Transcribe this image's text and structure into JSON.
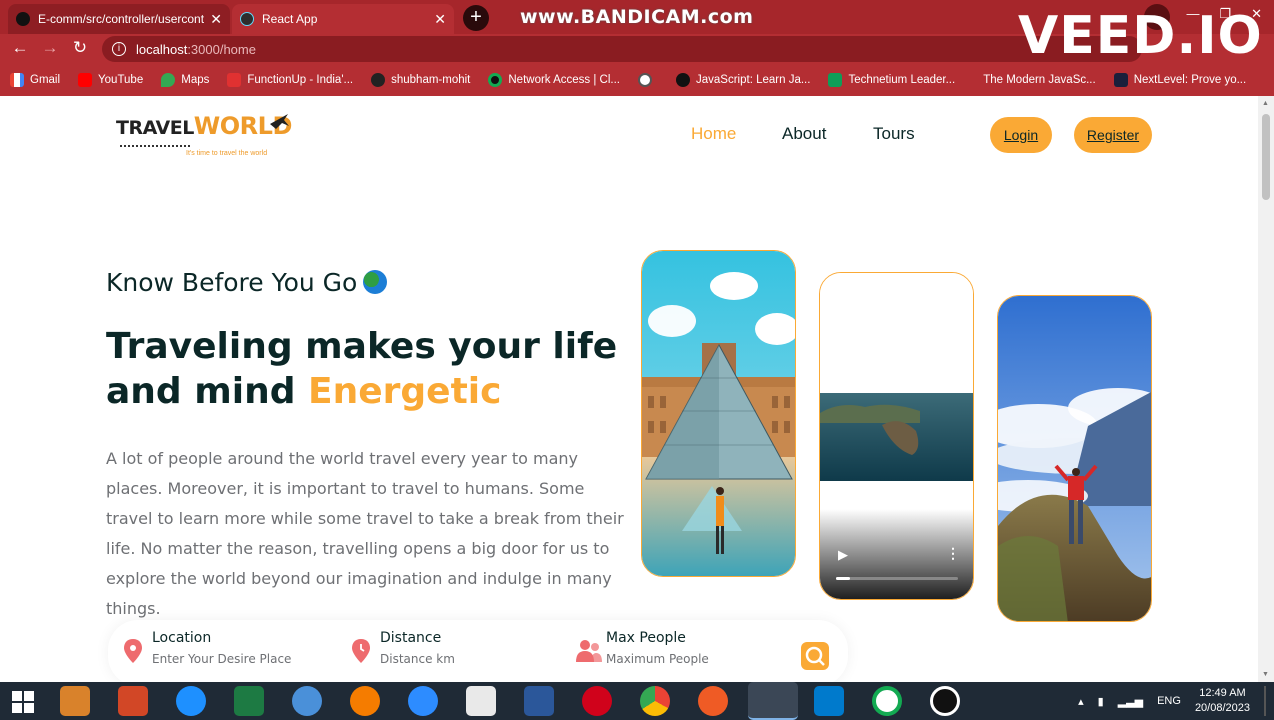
{
  "browser": {
    "tabs": [
      {
        "title": "E-comm/src/controller/usercontr",
        "active": false
      },
      {
        "title": "React App",
        "active": true
      }
    ],
    "url": {
      "host": "localhost",
      "path": ":3000/home"
    },
    "bookmarks": [
      {
        "label": "Gmail",
        "icon": "gmail-icon"
      },
      {
        "label": "YouTube",
        "icon": "youtube-icon"
      },
      {
        "label": "Maps",
        "icon": "maps-icon"
      },
      {
        "label": "FunctionUp - India'...",
        "icon": "functionup-icon"
      },
      {
        "label": "shubham-mohit",
        "icon": "github-icon"
      },
      {
        "label": "Network Access | Cl...",
        "icon": "mongodb-icon"
      },
      {
        "label": "",
        "icon": "globe-icon"
      },
      {
        "label": "JavaScript: Learn Ja...",
        "icon": "udemy-icon"
      },
      {
        "label": "Technetium Leader...",
        "icon": "sheets-icon"
      },
      {
        "label": "The Modern JavaSc...",
        "icon": "page-icon"
      },
      {
        "label": "NextLevel: Prove yo...",
        "icon": "nextlevel-icon"
      }
    ],
    "watermarks": {
      "bandicam": "www.BANDICAM.com",
      "veed": "VEED.IO"
    }
  },
  "site": {
    "logo": {
      "main": "TRAVEL",
      "accent": "WORLD",
      "tagline": "It's time to travel the world"
    },
    "nav": {
      "home": "Home",
      "about": "About",
      "tours": "Tours"
    },
    "auth": {
      "login": "Login",
      "register": "Register"
    },
    "hero": {
      "subtitle": "Know Before You Go",
      "headline_part1": "Traveling makes your life and mind ",
      "headline_highlight": "Energetic",
      "description": "A lot of people around the world travel every year to many places. Moreover, it is important to travel to humans. Some travel to learn more while some travel to take a break from their life. No matter the reason, travelling opens a big door for us to explore the world beyond our imagination and indulge in many things."
    },
    "search": {
      "location": {
        "label": "Location",
        "placeholder": "Enter Your Desire Place"
      },
      "distance": {
        "label": "Distance",
        "placeholder": "Distance km"
      },
      "people": {
        "label": "Max People",
        "placeholder": "Maximum People"
      }
    },
    "accent_color": "#faa935",
    "heading_color": "#0b2727"
  },
  "taskbar": {
    "language": "ENG",
    "time": "12:49 AM",
    "date": "20/08/2023"
  }
}
